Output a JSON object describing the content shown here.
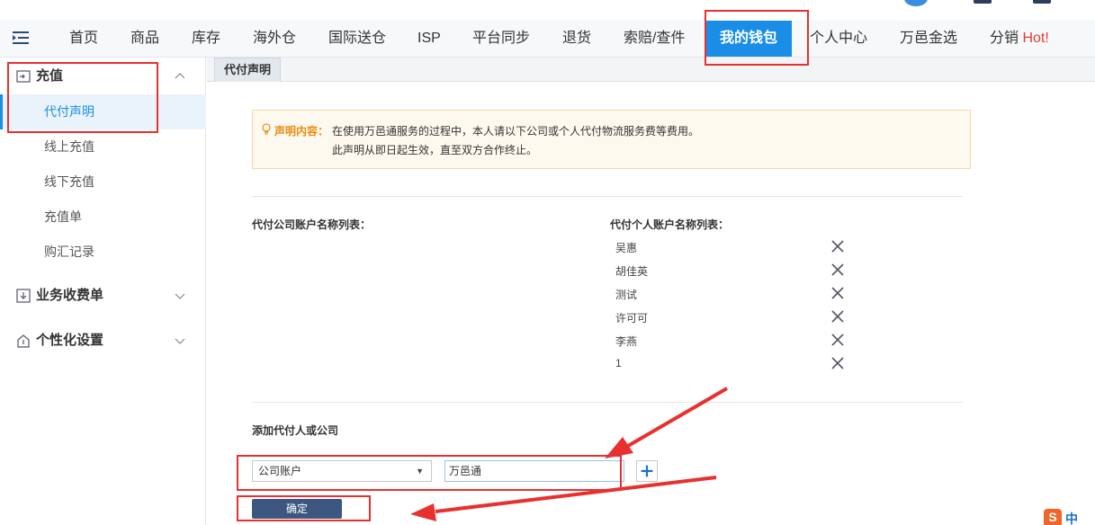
{
  "nav": {
    "items": [
      {
        "label": "首页"
      },
      {
        "label": "商品"
      },
      {
        "label": "库存"
      },
      {
        "label": "海外仓"
      },
      {
        "label": "国际送仓"
      },
      {
        "label": "ISP"
      },
      {
        "label": "平台同步"
      },
      {
        "label": "退货"
      },
      {
        "label": "索赔/查件"
      },
      {
        "label": "我的钱包"
      },
      {
        "label": "个人中心"
      },
      {
        "label": "万邑金选"
      },
      {
        "label": "分销",
        "badge": "Hot!"
      }
    ],
    "active_label": "我的钱包"
  },
  "sidebar": {
    "groups": [
      {
        "label": "充值",
        "icon": "recharge-icon",
        "expanded": true,
        "items": [
          {
            "label": "代付声明",
            "active": true
          },
          {
            "label": "线上充值"
          },
          {
            "label": "线下充值"
          },
          {
            "label": "充值单"
          },
          {
            "label": "购汇记录"
          }
        ]
      },
      {
        "label": "业务收费单",
        "icon": "download-doc-icon",
        "expanded": false
      },
      {
        "label": "个性化设置",
        "icon": "home-settings-icon",
        "expanded": false
      }
    ]
  },
  "tab": {
    "label": "代付声明"
  },
  "notice": {
    "label": "声明内容：",
    "line1": "在使用万邑通服务的过程中，本人请以下公司或个人代付物流服务费等费用。",
    "line2": "此声明从即日起生效，直至双方合作终止。"
  },
  "company_list": {
    "heading": "代付公司账户名称列表："
  },
  "person_list": {
    "heading": "代付个人账户名称列表：",
    "names": [
      "吴惠",
      "胡佳英",
      "测试",
      "许可可",
      "李燕",
      "1"
    ]
  },
  "add_form": {
    "label": "添加代付人或公司",
    "account_type": "公司账户",
    "name_value": "万邑通",
    "confirm_label": "确定"
  },
  "ime": {
    "logo": "S",
    "mode": "中"
  },
  "colors": {
    "accent": "#1a8ee6",
    "annotation_red": "#e8302f",
    "confirm_button": "#3d5880",
    "notice_label": "#e88b12"
  }
}
